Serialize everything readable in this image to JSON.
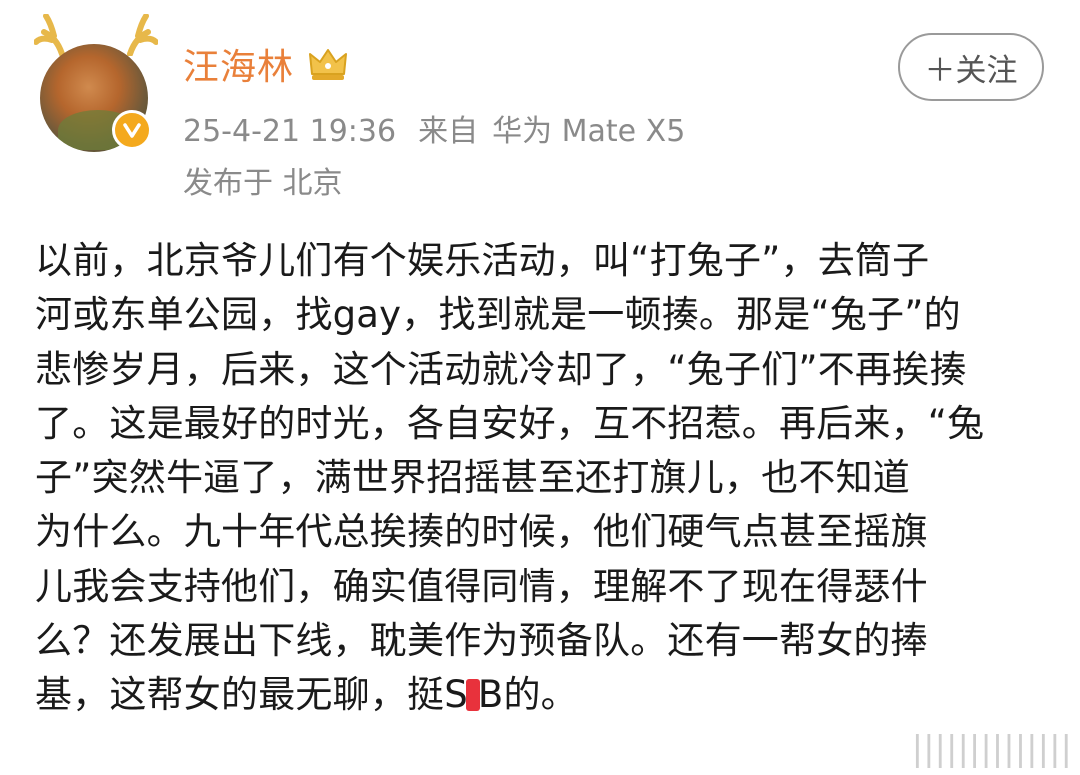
{
  "user": {
    "name": "汪海林",
    "crown_icon": "vip-crown-icon",
    "verified_icon": "verified-badge-icon",
    "avatar_icon": "cat-avatar-with-antlers"
  },
  "follow_button": {
    "label": "＋关注"
  },
  "meta": {
    "timestamp": "25-4-21 19:36",
    "source_label": "来自",
    "source_device": "华为 Mate X5",
    "location": "发布于 北京"
  },
  "post": {
    "lines": [
      "以前，北京爷儿们有个娱乐活动，叫“打兔子”，去筒子",
      "河或东单公园，找gay，找到就是一顿揍。那是“兔子”的",
      "悲惨岁月，后来，这个活动就冷却了，“兔子们”不再挨揍",
      "了。这是最好的时光，各自安好，互不招惹。再后来，“兔",
      "子”突然牛逼了，满世界招摇甚至还打旗儿，也不知道",
      "为什么。九十年代总挨揍的时候，他们硬气点甚至摇旗",
      "儿我会支持他们，确实值得同情，理解不了现在得瑟什",
      "么？还发展出下线，耽美作为预备队。还有一帮女的捧"
    ],
    "last_line_before": "基，这帮女的最无聊，挺S",
    "last_line_after": "B的。"
  },
  "watermark": {
    "text": "||||||||||||||"
  },
  "colors": {
    "username": "#e9803a",
    "meta_gray": "#8a8a8a",
    "text": "#1a1a1a",
    "redaction": "#e8323c",
    "verified": "#f4a91d"
  }
}
